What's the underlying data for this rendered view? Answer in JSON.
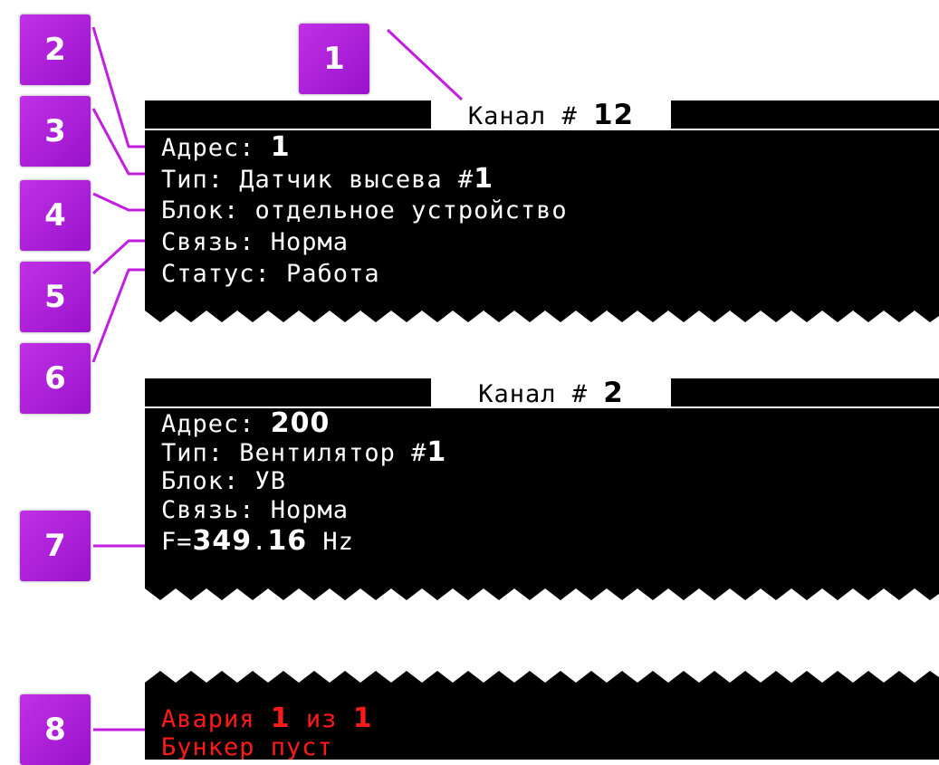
{
  "callouts": [
    "1",
    "2",
    "3",
    "4",
    "5",
    "6",
    "7",
    "8"
  ],
  "screen1": {
    "title_label": "Канал # ",
    "title_number": "12",
    "address_label": "Адрес: ",
    "address_value": "1",
    "type_label": "Тип: Датчик высева #",
    "type_number": "1",
    "block": "Блок: отдельное устройство",
    "link": "Связь: Норма",
    "status": "Статус: Работа"
  },
  "screen2": {
    "title_label": "Канал # ",
    "title_number": "2",
    "address_label": "Адрес: ",
    "address_value": "200",
    "type_label": "Тип: Вентилятор #",
    "type_number": "1",
    "block": "Блок: УВ",
    "link": "Связь: Норма",
    "freq_prefix": "F=",
    "freq_value": "349",
    "freq_dot": ".",
    "freq_frac": "16",
    "freq_unit": " Hz"
  },
  "screen3": {
    "alarm_label": "Авария ",
    "alarm_current": "1",
    "alarm_sep": " из ",
    "alarm_total": "1",
    "message": "Бункер пуст"
  },
  "colors": {
    "badge": "#b020dd",
    "leader": "#c21ee0",
    "screen": "#000000",
    "alarm": "#ff1a1a"
  }
}
